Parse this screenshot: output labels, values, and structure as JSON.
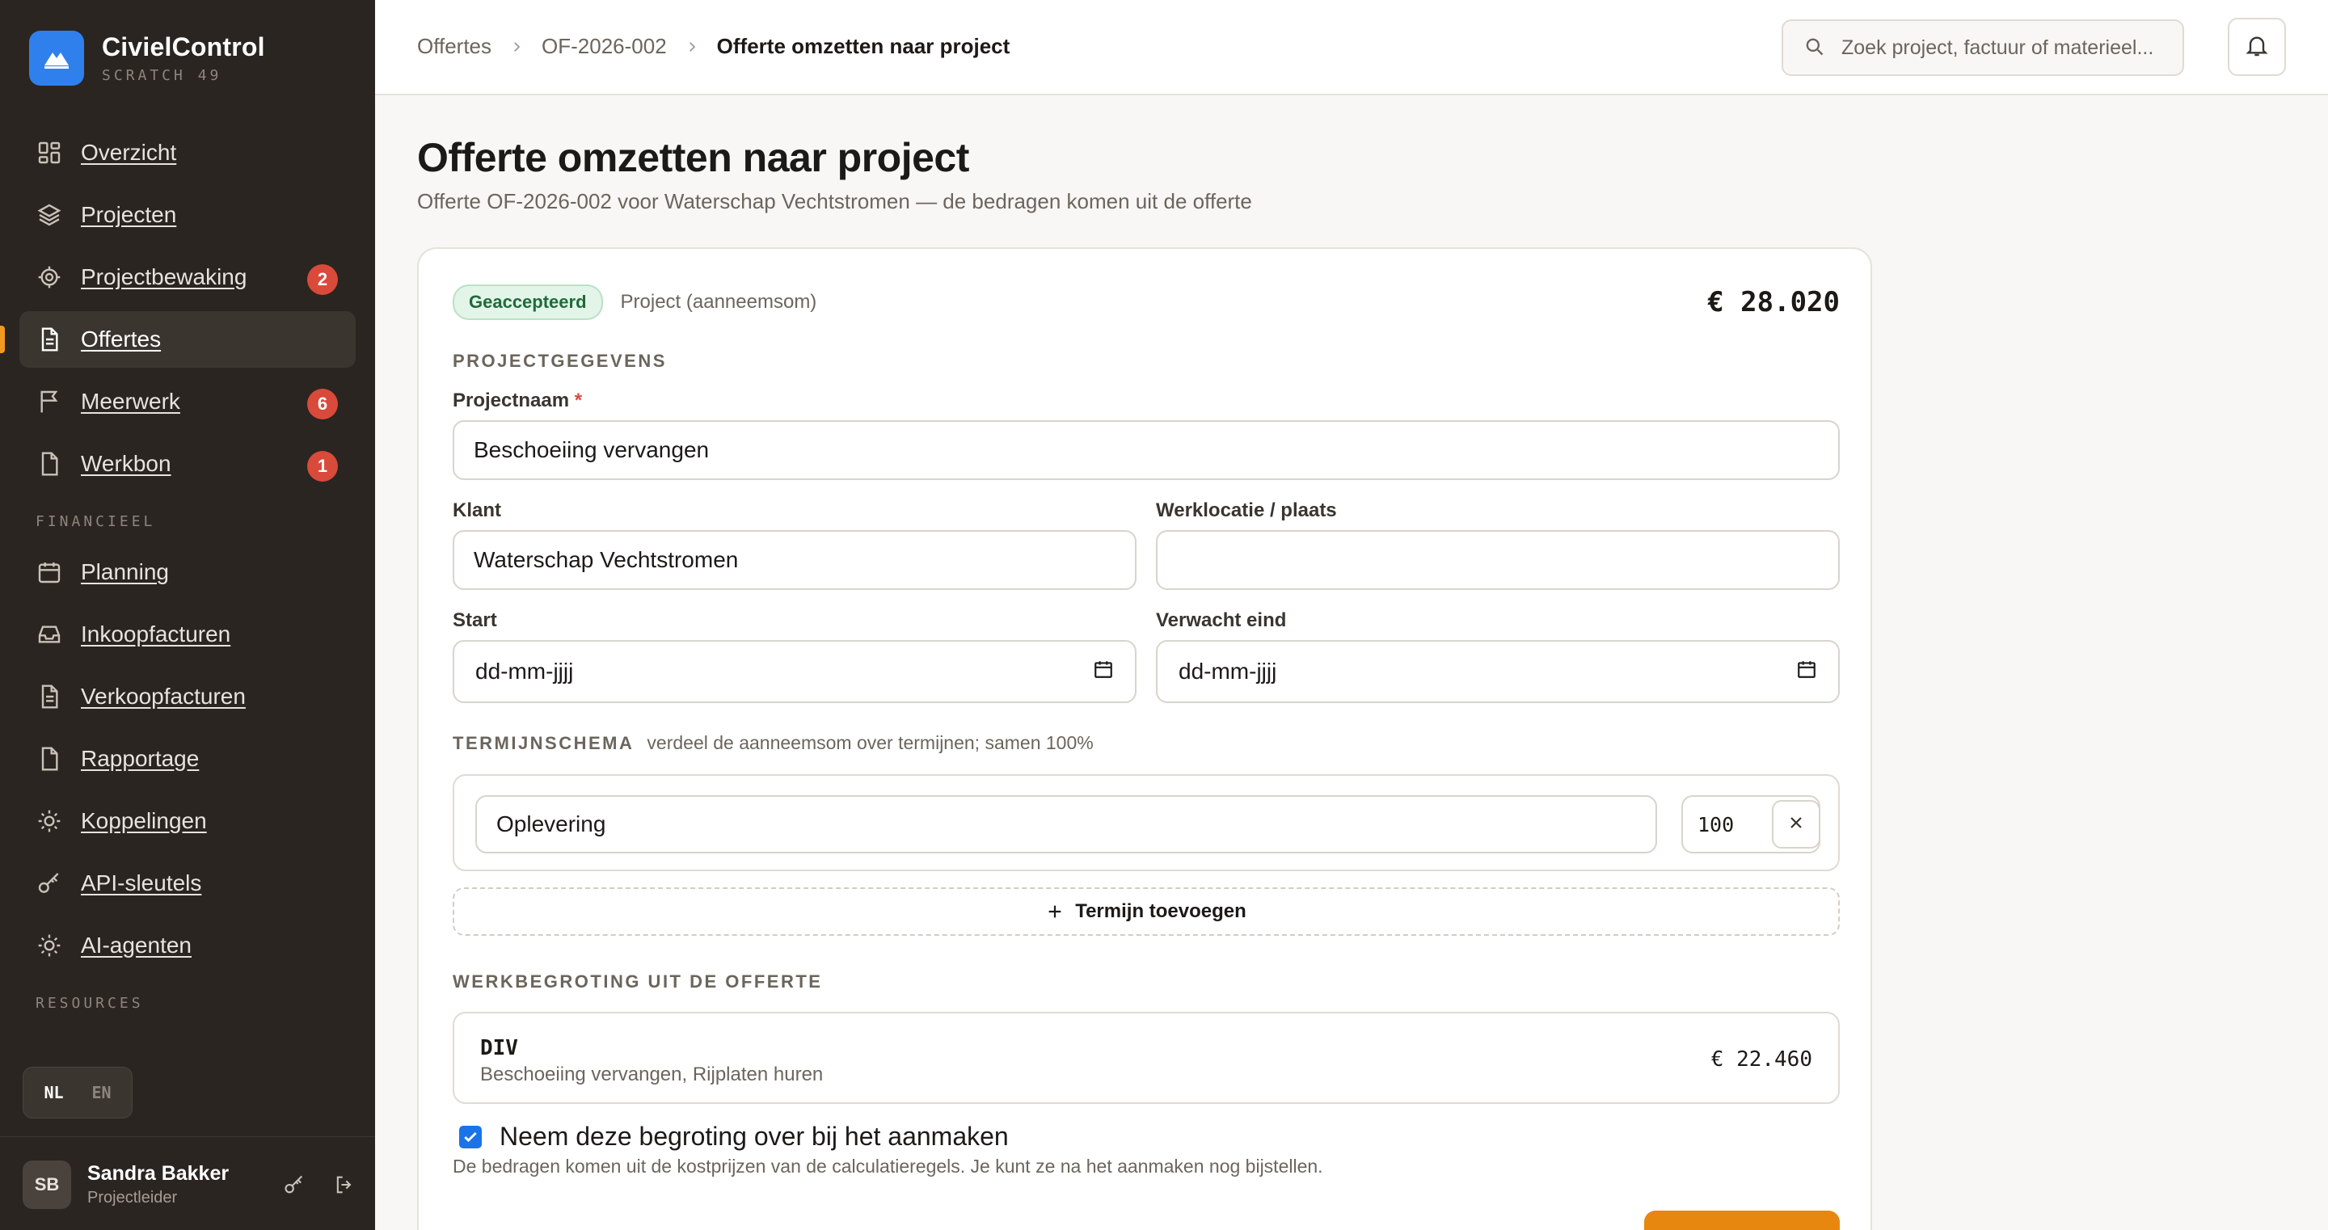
{
  "brand": {
    "name": "CivielControl",
    "sub": "SCRATCH 49"
  },
  "nav": {
    "items": [
      {
        "label": "Overzicht",
        "icon": "dashboard-icon",
        "badge": ""
      },
      {
        "label": "Projecten",
        "icon": "layers-icon",
        "badge": ""
      },
      {
        "label": "Projectbewaking",
        "icon": "target-icon",
        "badge": "2"
      },
      {
        "label": "Offertes",
        "icon": "document-icon",
        "badge": "",
        "active": true
      },
      {
        "label": "Meerwerk",
        "icon": "flag-icon",
        "badge": "6"
      },
      {
        "label": "Werkbon",
        "icon": "file-icon",
        "badge": "1"
      }
    ],
    "financieel_label": "FINANCIEEL",
    "financieel_items": [
      {
        "label": "Planning",
        "icon": "calendar-icon"
      },
      {
        "label": "Inkoopfacturen",
        "icon": "inbox-icon"
      },
      {
        "label": "Verkoopfacturen",
        "icon": "document-icon"
      },
      {
        "label": "Rapportage",
        "icon": "file-icon"
      },
      {
        "label": "Koppelingen",
        "icon": "sun-icon"
      },
      {
        "label": "API-sleutels",
        "icon": "key-icon"
      },
      {
        "label": "AI-agenten",
        "icon": "sun-icon"
      }
    ],
    "resources_label": "RESOURCES"
  },
  "lang": {
    "nl": "NL",
    "en": "EN"
  },
  "user": {
    "initials": "SB",
    "name": "Sandra Bakker",
    "role": "Projectleider"
  },
  "breadcrumb": {
    "item1": "Offertes",
    "item2": "OF-2026-002",
    "current": "Offerte omzetten naar project"
  },
  "search": {
    "placeholder": "Zoek project, factuur of materieel..."
  },
  "page": {
    "title": "Offerte omzetten naar project",
    "subtitle": "Offerte OF-2026-002 voor Waterschap Vechtstromen — de bedragen komen uit de offerte"
  },
  "card": {
    "status": "Geaccepteerd",
    "type": "Project (aanneemsom)",
    "amount": "€ 28.020",
    "section_project": "PROJECTGEGEVENS",
    "projectnaam_label": "Projectnaam",
    "required_mark": "*",
    "projectnaam_value": "Beschoeiing vervangen",
    "klant_label": "Klant",
    "klant_value": "Waterschap Vechtstromen",
    "werklocatie_label": "Werklocatie / plaats",
    "werklocatie_value": "",
    "start_label": "Start",
    "start_value": "dd-mm-jjjj",
    "eind_label": "Verwacht eind",
    "eind_value": "dd-mm-jjjj",
    "section_termijn": "TERMIJNSCHEMA",
    "termijn_hint": "verdeel de aanneemsom over termijnen; samen 100%",
    "termijn_name": "Oplevering",
    "termijn_pct": "100",
    "pct_sign": "%",
    "add_termijn": "Termijn toevoegen",
    "section_begroting": "WERKBEGROTING UIT DE OFFERTE",
    "budget_code": "DIV",
    "budget_desc": "Beschoeiing vervangen, Rijplaten huren",
    "budget_amount": "€ 22.460",
    "checkbox_label": "Neem deze begroting over bij het aanmaken",
    "checkbox_help": "De bedragen komen uit de kostprijzen van de calculatieregels. Je kunt ze na het aanmaken nog bijstellen."
  },
  "colors": {
    "accent": "#e8870f",
    "sidebar": "#2a2521",
    "brand": "#2f80ed",
    "badge": "#d94a3a",
    "success": "#1e6b3a"
  }
}
